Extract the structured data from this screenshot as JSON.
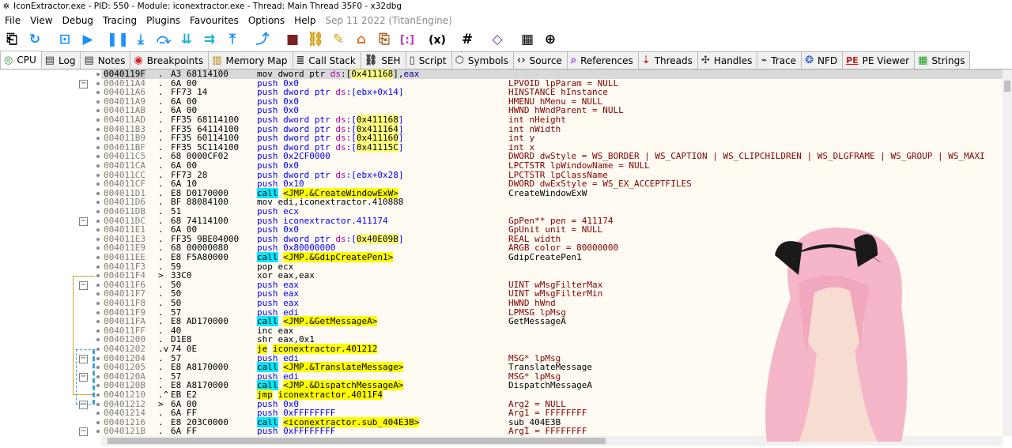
{
  "window": {
    "title": "IconExtractor.exe - PID: 550 - Module: iconextractor.exe - Thread: Main Thread 35F0 - x32dbg"
  },
  "menu": {
    "items": [
      "File",
      "View",
      "Debug",
      "Tracing",
      "Plugins",
      "Favourites",
      "Options",
      "Help"
    ],
    "info": "Sep 11 2022 (TitanEngine)"
  },
  "toolbar": {
    "icons": [
      "open-icon",
      "restart-icon",
      "close-icon",
      "run-icon",
      "pause-icon",
      "step-into-icon",
      "step-over-icon",
      "trace-into-icon",
      "trace-over-icon",
      "execute-till-return-icon",
      "run-to-user-code-icon",
      "stop-icon",
      "patch-icon",
      "comment-icon",
      "label-icon",
      "bookmark-icon",
      "function-icon",
      "expression-icon",
      "hash-icon",
      "variables-icon",
      "calculator-icon",
      "web-icon"
    ],
    "expr_label": "(x)",
    "hash_label": "#"
  },
  "tabs": [
    {
      "label": "CPU",
      "icon": "cpu-icon",
      "glyph": "◎",
      "color": "#2a8a2a",
      "active": true
    },
    {
      "label": "Log",
      "icon": "log-icon",
      "glyph": "▤",
      "color": "#333"
    },
    {
      "label": "Notes",
      "icon": "notes-icon",
      "glyph": "▤",
      "color": "#333"
    },
    {
      "label": "Breakpoints",
      "icon": "breakpoints-icon",
      "glyph": "◉",
      "color": "#d02020"
    },
    {
      "label": "Memory Map",
      "icon": "memory-map-icon",
      "glyph": "▥",
      "color": "#b8860b"
    },
    {
      "label": "Call Stack",
      "icon": "call-stack-icon",
      "glyph": "≣",
      "color": "#333"
    },
    {
      "label": "SEH",
      "icon": "seh-icon",
      "glyph": "⛓",
      "color": "#333"
    },
    {
      "label": "Script",
      "icon": "script-icon",
      "glyph": "▯",
      "color": "#333"
    },
    {
      "label": "Symbols",
      "icon": "symbols-icon",
      "glyph": "⬡",
      "color": "#333"
    },
    {
      "label": "Source",
      "icon": "source-icon",
      "glyph": "‹›",
      "color": "#333"
    },
    {
      "label": "References",
      "icon": "references-icon",
      "glyph": "⌕",
      "color": "#8a2be2"
    },
    {
      "label": "Threads",
      "icon": "threads-icon",
      "glyph": "⇣",
      "color": "#c03030"
    },
    {
      "label": "Handles",
      "icon": "handles-icon",
      "glyph": "✣",
      "color": "#333"
    },
    {
      "label": "Trace",
      "icon": "trace-icon",
      "glyph": "⌁",
      "color": "#333"
    },
    {
      "label": "NFD",
      "icon": "nfd-icon",
      "glyph": "❂",
      "color": "#2050c0"
    },
    {
      "label": "PE Viewer",
      "icon": "pe-viewer-icon",
      "glyph": "PE",
      "color": "#c02020"
    },
    {
      "label": "Strings",
      "icon": "strings-icon",
      "glyph": "▦",
      "color": "#20a020"
    }
  ],
  "disasm": {
    "rows": [
      {
        "addr": "0040119F",
        "mk": ".",
        "bytes": "A3 68114100",
        "ins": [
          [
            "def",
            "mov dword ptr "
          ],
          [
            "seg",
            "ds"
          ],
          [
            "def",
            ":["
          ],
          [
            "mem",
            "0x411168"
          ],
          [
            "def",
            "],"
          ],
          [
            "reg",
            "eax"
          ]
        ],
        "cmt": "",
        "sel": true
      },
      {
        "addr": "004011A4",
        "mk": ".",
        "bytes": "6A 00",
        "ins": [
          [
            "push",
            "push 0x0"
          ]
        ],
        "cmt": "LPVOID lpParam = NULL"
      },
      {
        "addr": "004011A6",
        "mk": ".",
        "bytes": "FF73 14",
        "ins": [
          [
            "push",
            "push dword ptr "
          ],
          [
            "seg",
            "ds"
          ],
          [
            "push",
            ":["
          ],
          [
            "push",
            "ebx+0x14"
          ],
          [
            "push",
            "]"
          ]
        ],
        "cmt": "HINSTANCE hInstance"
      },
      {
        "addr": "004011A9",
        "mk": ".",
        "bytes": "6A 00",
        "ins": [
          [
            "push",
            "push 0x0"
          ]
        ],
        "cmt": "HMENU hMenu = NULL"
      },
      {
        "addr": "004011AB",
        "mk": ".",
        "bytes": "6A 00",
        "ins": [
          [
            "push",
            "push 0x0"
          ]
        ],
        "cmt": "HWND hWndParent = NULL"
      },
      {
        "addr": "004011AD",
        "mk": ".",
        "bytes": "FF35 68114100",
        "ins": [
          [
            "push",
            "push dword ptr "
          ],
          [
            "seg",
            "ds"
          ],
          [
            "push",
            ":["
          ],
          [
            "mem",
            "0x411168"
          ],
          [
            "push",
            "]"
          ]
        ],
        "cmt": "int nHeight"
      },
      {
        "addr": "004011B3",
        "mk": ".",
        "bytes": "FF35 64114100",
        "ins": [
          [
            "push",
            "push dword ptr "
          ],
          [
            "seg",
            "ds"
          ],
          [
            "push",
            ":["
          ],
          [
            "mem",
            "0x411164"
          ],
          [
            "push",
            "]"
          ]
        ],
        "cmt": "int nWidth"
      },
      {
        "addr": "004011B9",
        "mk": ".",
        "bytes": "FF35 60114100",
        "ins": [
          [
            "push",
            "push dword ptr "
          ],
          [
            "seg",
            "ds"
          ],
          [
            "push",
            ":["
          ],
          [
            "mem",
            "0x411160"
          ],
          [
            "push",
            "]"
          ]
        ],
        "cmt": "int y"
      },
      {
        "addr": "004011BF",
        "mk": ".",
        "bytes": "FF35 5C114100",
        "ins": [
          [
            "push",
            "push dword ptr "
          ],
          [
            "seg",
            "ds"
          ],
          [
            "push",
            ":["
          ],
          [
            "mem",
            "0x41115C"
          ],
          [
            "push",
            "]"
          ]
        ],
        "cmt": "int x"
      },
      {
        "addr": "004011C5",
        "mk": ".",
        "bytes": "68 0000CF02",
        "ins": [
          [
            "push",
            "push 0x2CF0000"
          ]
        ],
        "cmt": "DWORD dwStyle = WS_BORDER | WS_CAPTION | WS_CLIPCHILDREN | WS_DLGFRAME | WS_GROUP | WS_MAXI"
      },
      {
        "addr": "004011CA",
        "mk": ".",
        "bytes": "6A 00",
        "ins": [
          [
            "push",
            "push 0x0"
          ]
        ],
        "cmt": "LPCTSTR lpWindowName = NULL"
      },
      {
        "addr": "004011CC",
        "mk": ".",
        "bytes": "FF73 28",
        "ins": [
          [
            "push",
            "push dword ptr "
          ],
          [
            "seg",
            "ds"
          ],
          [
            "push",
            ":["
          ],
          [
            "push",
            "ebx+0x28"
          ],
          [
            "push",
            "]"
          ]
        ],
        "cmt": "LPCTSTR lpClassName"
      },
      {
        "addr": "004011CF",
        "mk": ".",
        "bytes": "6A 10",
        "ins": [
          [
            "push",
            "push 0x10"
          ]
        ],
        "cmt": "DWORD dwExStyle = WS_EX_ACCEPTFILES"
      },
      {
        "addr": "004011D1",
        "mk": ".",
        "bytes": "E8 D0170000",
        "ins": [
          [
            "call",
            "call"
          ],
          [
            "def",
            " "
          ],
          [
            "tgt",
            "<JMP.&CreateWindowExW>"
          ]
        ],
        "cmt": "CreateWindowExW",
        "plain": true
      },
      {
        "addr": "004011D6",
        "mk": ".",
        "bytes": "BF 88084100",
        "ins": [
          [
            "def",
            "mov edi,iconextractor.410888"
          ]
        ],
        "cmt": ""
      },
      {
        "addr": "004011DB",
        "mk": ".",
        "bytes": "51",
        "ins": [
          [
            "push",
            "push ecx"
          ]
        ],
        "cmt": ""
      },
      {
        "addr": "004011DC",
        "mk": ".",
        "bytes": "68 74114100",
        "ins": [
          [
            "push",
            "push iconextractor.411174"
          ]
        ],
        "cmt": "GpPen** pen = 411174"
      },
      {
        "addr": "004011E1",
        "mk": ".",
        "bytes": "6A 00",
        "ins": [
          [
            "push",
            "push 0x0"
          ]
        ],
        "cmt": "GpUnit unit = NULL"
      },
      {
        "addr": "004011E3",
        "mk": ".",
        "bytes": "FF35 9BE04000",
        "ins": [
          [
            "push",
            "push dword ptr "
          ],
          [
            "seg",
            "ds"
          ],
          [
            "push",
            ":["
          ],
          [
            "mem",
            "0x40E09B"
          ],
          [
            "push",
            "]"
          ]
        ],
        "cmt": "REAL width"
      },
      {
        "addr": "004011E9",
        "mk": ".",
        "bytes": "68 00000080",
        "ins": [
          [
            "push",
            "push 0x80000000"
          ]
        ],
        "cmt": "ARGB color = 80000000"
      },
      {
        "addr": "004011EE",
        "mk": ".",
        "bytes": "E8 F5A80000",
        "ins": [
          [
            "call",
            "call"
          ],
          [
            "def",
            " "
          ],
          [
            "tgt",
            "<JMP.&GdipCreatePen1>"
          ]
        ],
        "cmt": "GdipCreatePen1",
        "plain": true
      },
      {
        "addr": "004011F3",
        "mk": ".",
        "bytes": "59",
        "ins": [
          [
            "def",
            "pop ecx"
          ]
        ],
        "cmt": ""
      },
      {
        "addr": "004011F4",
        "mk": ">",
        "bytes": "33C0",
        "ins": [
          [
            "def",
            "xor eax,eax"
          ]
        ],
        "cmt": ""
      },
      {
        "addr": "004011F6",
        "mk": ".",
        "bytes": "50",
        "ins": [
          [
            "push",
            "push eax"
          ]
        ],
        "cmt": "UINT wMsgFilterMax"
      },
      {
        "addr": "004011F7",
        "mk": ".",
        "bytes": "50",
        "ins": [
          [
            "push",
            "push eax"
          ]
        ],
        "cmt": "UINT wMsgFilterMin"
      },
      {
        "addr": "004011F8",
        "mk": ".",
        "bytes": "50",
        "ins": [
          [
            "push",
            "push eax"
          ]
        ],
        "cmt": "HWND hWnd"
      },
      {
        "addr": "004011F9",
        "mk": ".",
        "bytes": "57",
        "ins": [
          [
            "push",
            "push edi"
          ]
        ],
        "cmt": "LPMSG lpMsg"
      },
      {
        "addr": "004011FA",
        "mk": ".",
        "bytes": "E8 AD170000",
        "ins": [
          [
            "call",
            "call"
          ],
          [
            "def",
            " "
          ],
          [
            "tgt",
            "<JMP.&GetMessageA>"
          ]
        ],
        "cmt": "GetMessageA",
        "plain": true
      },
      {
        "addr": "004011FF",
        "mk": ".",
        "bytes": "40",
        "ins": [
          [
            "def",
            "inc eax"
          ]
        ],
        "cmt": ""
      },
      {
        "addr": "00401200",
        "mk": ".",
        "bytes": "D1E8",
        "ins": [
          [
            "def",
            "shr eax,0x1"
          ]
        ],
        "cmt": ""
      },
      {
        "addr": "00401202",
        "mk": ".v",
        "bytes": "74 0E",
        "ins": [
          [
            "jmp",
            "je"
          ],
          [
            "def",
            " "
          ],
          [
            "tgt",
            "iconextractor.401212"
          ]
        ],
        "cmt": ""
      },
      {
        "addr": "00401204",
        "mk": ".",
        "bytes": "57",
        "ins": [
          [
            "push",
            "push edi"
          ]
        ],
        "cmt": "MSG* lpMsg"
      },
      {
        "addr": "00401205",
        "mk": ".",
        "bytes": "E8 A8170000",
        "ins": [
          [
            "call",
            "call"
          ],
          [
            "def",
            " "
          ],
          [
            "tgt",
            "<JMP.&TranslateMessage>"
          ]
        ],
        "cmt": "TranslateMessage",
        "plain": true
      },
      {
        "addr": "0040120A",
        "mk": ".",
        "bytes": "57",
        "ins": [
          [
            "push",
            "push edi"
          ]
        ],
        "cmt": "MSG* lpMsg"
      },
      {
        "addr": "0040120B",
        "mk": ".",
        "bytes": "E8 A8170000",
        "ins": [
          [
            "call",
            "call"
          ],
          [
            "def",
            " "
          ],
          [
            "tgt",
            "<JMP.&DispatchMessageA>"
          ]
        ],
        "cmt": "DispatchMessageA",
        "plain": true
      },
      {
        "addr": "00401210",
        "mk": ".^",
        "bytes": "EB E2",
        "ins": [
          [
            "jmp",
            "jmp"
          ],
          [
            "def",
            " "
          ],
          [
            "tgt",
            "iconextractor.4011F4"
          ]
        ],
        "cmt": ""
      },
      {
        "addr": "00401212",
        "mk": ">",
        "bytes": "6A 00",
        "ins": [
          [
            "push",
            "push 0x0"
          ]
        ],
        "cmt": "Arg2 = NULL"
      },
      {
        "addr": "00401214",
        "mk": ".",
        "bytes": "6A FF",
        "ins": [
          [
            "push",
            "push 0xFFFFFFFF"
          ]
        ],
        "cmt": "Arg1 = FFFFFFFF"
      },
      {
        "addr": "00401216",
        "mk": ".",
        "bytes": "E8 203C0000",
        "ins": [
          [
            "call",
            "call"
          ],
          [
            "def",
            " "
          ],
          [
            "tgt",
            "<iconextractor.sub_404E3B>"
          ]
        ],
        "cmt": "sub_404E3B",
        "plain": true
      },
      {
        "addr": "0040121B",
        "mk": ".",
        "bytes": "6A FF",
        "ins": [
          [
            "push",
            "push 0xFFFFFFFF"
          ]
        ],
        "cmt": "Arg1 = FFFFFFFF"
      }
    ],
    "fold_rows": [
      1,
      16,
      23,
      31,
      33,
      36,
      39
    ]
  }
}
